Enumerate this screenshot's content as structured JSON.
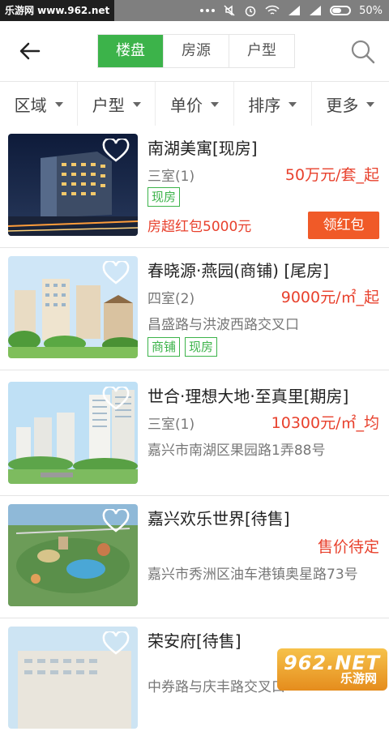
{
  "statusbar": {
    "site": "乐游网 www.962.net",
    "battery": "50%"
  },
  "header": {
    "tabs": [
      {
        "label": "楼盘",
        "active": true
      },
      {
        "label": "房源"
      },
      {
        "label": "户型"
      }
    ]
  },
  "filters": [
    "区域",
    "户型",
    "单价",
    "排序",
    "更多"
  ],
  "listings": [
    {
      "title": "南湖美寓[现房]",
      "rooms": "三室(1)",
      "price": "50万元/套_起",
      "tags": [
        "现房"
      ],
      "promo": "房超红包5000元",
      "button": "领红包",
      "image": "night-building"
    },
    {
      "title": "春晓源·燕园(商铺) [尾房]",
      "rooms": "四室(2)",
      "price": "9000元/㎡_起",
      "address": "昌盛路与洪波西路交叉口",
      "tags": [
        "商铺",
        "现房"
      ],
      "image": "apartments-trees"
    },
    {
      "title": "世合·理想大地·至真里[期房]",
      "rooms": "三室(1)",
      "price": "10300元/㎡_均",
      "address": "嘉兴市南湖区果园路1弄88号",
      "image": "towers-daylight"
    },
    {
      "title": "嘉兴欢乐世界[待售]",
      "price": "售价待定",
      "address": "嘉兴市秀洲区油车港镇奥星路73号",
      "image": "theme-park"
    },
    {
      "title": "荣安府[待售]",
      "address": "中券路与庆丰路交叉口",
      "image": "residential"
    }
  ],
  "watermark": {
    "brand": "962.NET",
    "sub": "乐游网"
  },
  "colors": {
    "accent": "#3cb34a",
    "price": "#e8412d",
    "button": "#f05a28"
  }
}
